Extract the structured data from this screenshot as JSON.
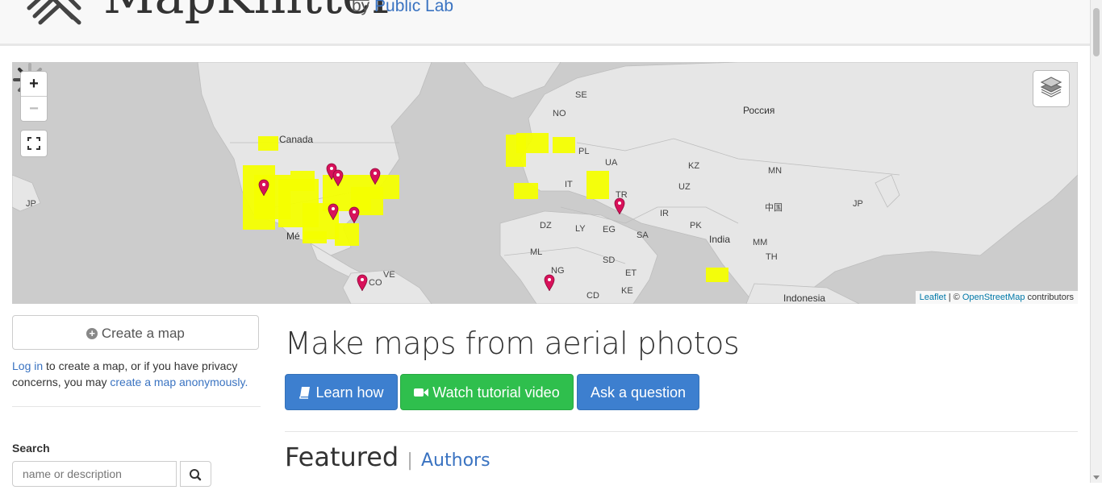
{
  "header": {
    "brand": "MapKnitter",
    "by": "by",
    "org": "Public Lab"
  },
  "map": {
    "zoom_in": "+",
    "zoom_out": "−",
    "labels": [
      {
        "text": "Canada"
      },
      {
        "text": "SE"
      },
      {
        "text": "NO"
      },
      {
        "text": "Россия"
      },
      {
        "text": "PL"
      },
      {
        "text": "UA"
      },
      {
        "text": "KZ"
      },
      {
        "text": "MN"
      },
      {
        "text": "UZ"
      },
      {
        "text": "IT"
      },
      {
        "text": "TR"
      },
      {
        "text": "JP"
      },
      {
        "text": "JP"
      },
      {
        "text": "中国"
      },
      {
        "text": "IR"
      },
      {
        "text": "PK"
      },
      {
        "text": "India"
      },
      {
        "text": "MM"
      },
      {
        "text": "TH"
      },
      {
        "text": "DZ"
      },
      {
        "text": "LY"
      },
      {
        "text": "EG"
      },
      {
        "text": "SA"
      },
      {
        "text": "ML"
      },
      {
        "text": "NG"
      },
      {
        "text": "SD"
      },
      {
        "text": "ET"
      },
      {
        "text": "KE"
      },
      {
        "text": "CD"
      },
      {
        "text": "VE"
      },
      {
        "text": "CO"
      },
      {
        "text": "Mé"
      },
      {
        "text": "Indonesia"
      }
    ],
    "attribution": {
      "leaflet": "Leaflet",
      "sep": " | © ",
      "osm": "OpenStreetMap",
      "suffix": " contributors"
    }
  },
  "sidebar": {
    "create_map": "Create a map",
    "login_link": "Log in",
    "login_text": " to create a map, or if you have privacy concerns, you may ",
    "anon_link": "create a map anonymously.",
    "search_label": "Search",
    "search_placeholder": "name or description"
  },
  "main": {
    "title": "Make maps from aerial photos",
    "learn_how": "Learn how",
    "watch_video": "Watch tutorial video",
    "ask_question": "Ask a question",
    "featured": "Featured",
    "authors": "Authors",
    "sep": "|"
  },
  "colors": {
    "map_bg": "#cccccc",
    "land": "#e6e6e6",
    "overlay": "#f4ff00",
    "marker": "#d8115a",
    "btn_primary": "#3d7fcf",
    "btn_success": "#2fbf4d"
  }
}
